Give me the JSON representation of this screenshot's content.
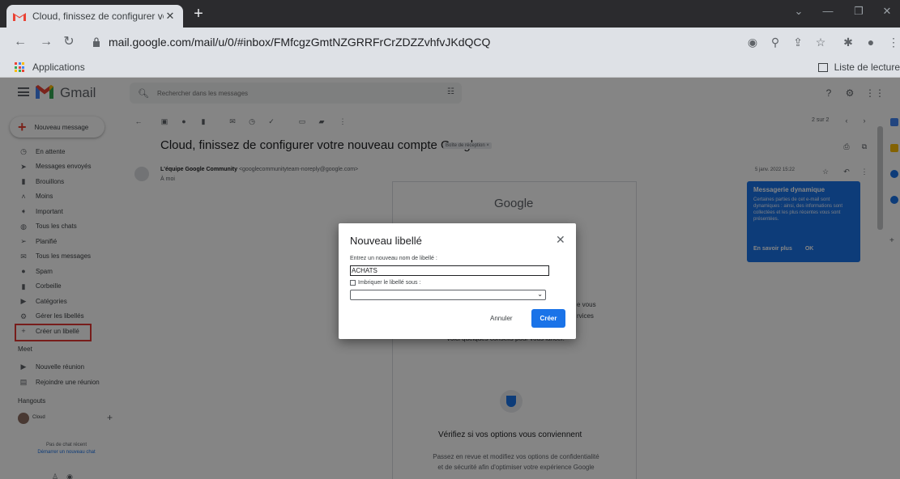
{
  "browser": {
    "tab_title": "Cloud, finissez de configurer votr",
    "url": "mail.google.com/mail/u/0/#inbox/FMfcgzGmtNZGRRFrCrZDZZvhfvJKdQCQ",
    "bookmarks_apps": "Applications",
    "reading_list": "Liste de lecture"
  },
  "gmail": {
    "brand": "Gmail",
    "search_placeholder": "Rechercher dans les messages",
    "compose_label": "Nouveau message",
    "sidebar": [
      {
        "label": "En attente",
        "icon": "clock-icon"
      },
      {
        "label": "Messages envoyés",
        "icon": "send-icon"
      },
      {
        "label": "Brouillons",
        "icon": "draft-icon"
      },
      {
        "label": "Moins",
        "icon": "chevron-up-icon"
      },
      {
        "label": "Important",
        "icon": "important-icon"
      },
      {
        "label": "Tous les chats",
        "icon": "chat-icon"
      },
      {
        "label": "Planifié",
        "icon": "scheduled-icon"
      },
      {
        "label": "Tous les messages",
        "icon": "all-mail-icon"
      },
      {
        "label": "Spam",
        "icon": "spam-icon"
      },
      {
        "label": "Corbeille",
        "icon": "trash-icon"
      },
      {
        "label": "Catégories",
        "icon": "label-icon"
      },
      {
        "label": "Gérer les libellés",
        "icon": "gear-icon"
      },
      {
        "label": "Créer un libellé",
        "icon": "plus-icon"
      }
    ],
    "meet_title": "Meet",
    "meet_items": [
      "Nouvelle réunion",
      "Rejoindre une réunion"
    ],
    "hangouts_title": "Hangouts",
    "hangouts_user": "Cloud",
    "no_chat": "Pas de chat récent",
    "start_chat": "Démarrer un nouveau chat",
    "pager": "2 sur 2",
    "email": {
      "subject": "Cloud, finissez de configurer votre nouveau compte Google",
      "chip": "Boîte de réception ×",
      "sender_name": "L'équipe Google Community",
      "sender_addr": "<googlecommunityteam-noreply@google.com>",
      "to": "À moi",
      "date": "5 janv. 2022 15:22",
      "logo": "Google",
      "partial_1": "e vous",
      "partial_2": "rvices",
      "partial_3": "Voici quelques conseils pour vous lancer.",
      "verify_title": "Vérifiez si vos options vous conviennent",
      "verify_body": "Passez en revue et modifiez vos options de confidentialité et de sécurité afin d'optimiser votre expérience Google"
    },
    "dynamic_card": {
      "title": "Messagerie dynamique",
      "body": "Certaines parties de cet e-mail sont dynamiques : ainsi, des informations sont collectées et les plus récentes vous sont présentées.",
      "learn_more": "En savoir plus",
      "ok": "OK"
    }
  },
  "dialog": {
    "title": "Nouveau libellé",
    "name_label": "Entrez un nouveau nom de libellé :",
    "name_value": "ACHATS",
    "nest_label": "Imbriquer le libellé sous :",
    "cancel": "Annuler",
    "create": "Créer"
  },
  "colors": {
    "accent": "#1a73e8",
    "highlight": "#e53935",
    "gmail_red": "#ea4335"
  }
}
